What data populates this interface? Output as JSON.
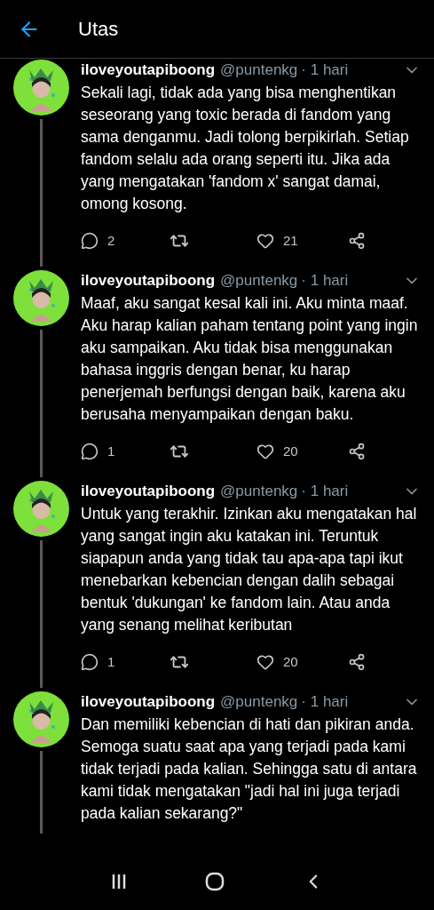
{
  "header": {
    "title": "Utas"
  },
  "tweets": [
    {
      "name": "iloveyoutapiboong",
      "handle": "@puntenkg",
      "time": "· 1 hari",
      "text": "Sekali lagi, tidak ada yang bisa menghentikan seseorang yang toxic berada di fandom yang sama denganmu. Jadi tolong berpikirlah. Setiap fandom selalu ada orang seperti itu. Jika ada yang mengatakan 'fandom x' sangat damai, omong kosong.",
      "replies": "2",
      "likes": "21"
    },
    {
      "name": "iloveyoutapiboong",
      "handle": "@puntenkg",
      "time": "· 1 hari",
      "text": "Maaf, aku sangat kesal kali ini. Aku minta maaf. Aku harap kalian paham tentang point yang ingin aku sampaikan. Aku tidak bisa menggunakan bahasa inggris dengan benar, ku harap penerjemah berfungsi dengan baik, karena aku berusaha menyampaikan dengan baku.",
      "replies": "1",
      "likes": "20"
    },
    {
      "name": "iloveyoutapiboong",
      "handle": "@puntenkg",
      "time": "· 1 hari",
      "text": "Untuk yang terakhir. Izinkan aku mengatakan hal yang sangat ingin aku katakan ini. Teruntuk siapapun anda yang tidak tau apa-apa tapi ikut menebarkan kebencian dengan dalih sebagai bentuk 'dukungan' ke fandom lain. Atau anda yang senang melihat keributan",
      "replies": "1",
      "likes": "20"
    },
    {
      "name": "iloveyoutapiboong",
      "handle": "@puntenkg",
      "time": "· 1 hari",
      "text": "Dan memiliki kebencian di hati dan pikiran anda. Semoga suatu saat apa yang terjadi pada kami tidak terjadi pada kalian. Sehingga satu di antara kami tidak mengatakan \"jadi hal ini juga terjadi pada kalian sekarang?\""
    }
  ]
}
